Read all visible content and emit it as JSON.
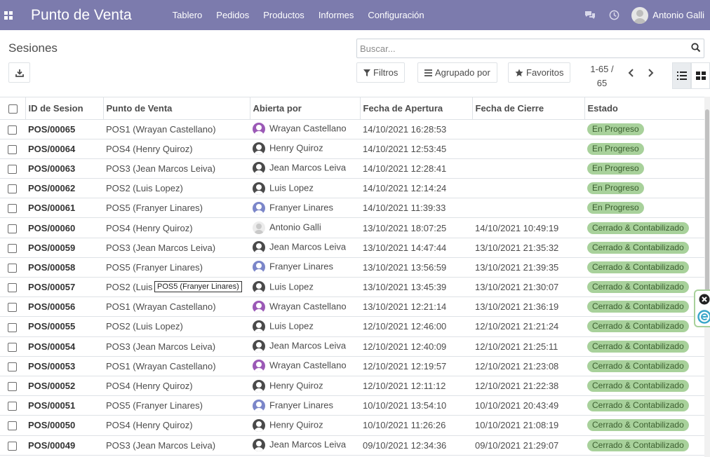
{
  "navbar": {
    "brand": "Punto de Venta",
    "menu": [
      "Tablero",
      "Pedidos",
      "Productos",
      "Informes",
      "Configuración"
    ],
    "user_name": "Antonio Galli"
  },
  "control_panel": {
    "breadcrumb": "Sesiones",
    "search_placeholder": "Buscar...",
    "filters_label": "Filtros",
    "group_by_label": "Agrupado por",
    "favorites_label": "Favoritos",
    "pager_value": "1-65 /",
    "pager_total": "65"
  },
  "table": {
    "headers": [
      "ID de Sesion",
      "Punto de Venta",
      "Abierta por",
      "Fecha de Apertura",
      "Fecha de Cierre",
      "Estado"
    ],
    "tooltip": "POS5 (Franyer Linares)",
    "colors": {
      "status_badge": "#a8d19b",
      "navbar": "#7c7bad"
    },
    "rows": [
      {
        "id": "POS/00065",
        "pos": "POS1 (Wrayan Castellano)",
        "user": "Wrayan Castellano",
        "avatar": "#9b59b6",
        "open": "14/10/2021 16:28:53",
        "close": "",
        "state": "En Progreso"
      },
      {
        "id": "POS/00064",
        "pos": "POS4 (Henry Quiroz)",
        "user": "Henry Quiroz",
        "avatar": "#4a4a4a",
        "open": "14/10/2021 12:53:45",
        "close": "",
        "state": "En Progreso"
      },
      {
        "id": "POS/00063",
        "pos": "POS3 (Jean Marcos Leiva)",
        "user": "Jean Marcos Leiva",
        "avatar": "#4a4a4a",
        "open": "14/10/2021 12:28:41",
        "close": "",
        "state": "En Progreso"
      },
      {
        "id": "POS/00062",
        "pos": "POS2 (Luis Lopez)",
        "user": "Luis Lopez",
        "avatar": "#4a4a4a",
        "open": "14/10/2021 12:14:24",
        "close": "",
        "state": "En Progreso"
      },
      {
        "id": "POS/00061",
        "pos": "POS5 (Franyer Linares)",
        "user": "Franyer Linares",
        "avatar": "#7b86c9",
        "open": "14/10/2021 11:39:33",
        "close": "",
        "state": "En Progreso"
      },
      {
        "id": "POS/00060",
        "pos": "POS4 (Henry Quiroz)",
        "user": "Antonio Galli",
        "avatar": "light",
        "open": "13/10/2021 18:07:25",
        "close": "14/10/2021 10:49:19",
        "state": "Cerrado & Contabilizado"
      },
      {
        "id": "POS/00059",
        "pos": "POS3 (Jean Marcos Leiva)",
        "user": "Jean Marcos Leiva",
        "avatar": "#4a4a4a",
        "open": "13/10/2021 14:47:44",
        "close": "13/10/2021 21:35:32",
        "state": "Cerrado & Contabilizado"
      },
      {
        "id": "POS/00058",
        "pos": "POS5 (Franyer Linares)",
        "user": "Franyer Linares",
        "avatar": "#7b86c9",
        "open": "13/10/2021 13:56:59",
        "close": "13/10/2021 21:39:35",
        "state": "Cerrado & Contabilizado"
      },
      {
        "id": "POS/00057",
        "pos": "POS2 (Luis",
        "user": "Luis Lopez",
        "avatar": "#4a4a4a",
        "open": "13/10/2021 13:45:39",
        "close": "13/10/2021 21:30:07",
        "state": "Cerrado & Contabilizado"
      },
      {
        "id": "POS/00056",
        "pos": "POS1 (Wrayan Castellano)",
        "user": "Wrayan Castellano",
        "avatar": "#9b59b6",
        "open": "13/10/2021 12:21:14",
        "close": "13/10/2021 21:36:19",
        "state": "Cerrado & Contabilizado"
      },
      {
        "id": "POS/00055",
        "pos": "POS2 (Luis Lopez)",
        "user": "Luis Lopez",
        "avatar": "#4a4a4a",
        "open": "12/10/2021 12:46:00",
        "close": "12/10/2021 21:21:24",
        "state": "Cerrado & Contabilizado"
      },
      {
        "id": "POS/00054",
        "pos": "POS3 (Jean Marcos Leiva)",
        "user": "Jean Marcos Leiva",
        "avatar": "#4a4a4a",
        "open": "12/10/2021 12:40:09",
        "close": "12/10/2021 21:25:11",
        "state": "Cerrado & Contabilizado"
      },
      {
        "id": "POS/00053",
        "pos": "POS1 (Wrayan Castellano)",
        "user": "Wrayan Castellano",
        "avatar": "#9b59b6",
        "open": "12/10/2021 12:19:57",
        "close": "12/10/2021 21:23:08",
        "state": "Cerrado & Contabilizado"
      },
      {
        "id": "POS/00052",
        "pos": "POS4 (Henry Quiroz)",
        "user": "Henry Quiroz",
        "avatar": "#4a4a4a",
        "open": "12/10/2021 12:11:12",
        "close": "12/10/2021 21:22:38",
        "state": "Cerrado & Contabilizado"
      },
      {
        "id": "POS/00051",
        "pos": "POS5 (Franyer Linares)",
        "user": "Franyer Linares",
        "avatar": "#7b86c9",
        "open": "10/10/2021 13:54:10",
        "close": "10/10/2021 20:43:49",
        "state": "Cerrado & Contabilizado"
      },
      {
        "id": "POS/00050",
        "pos": "POS4 (Henry Quiroz)",
        "user": "Henry Quiroz",
        "avatar": "#4a4a4a",
        "open": "10/10/2021 11:26:26",
        "close": "10/10/2021 21:08:19",
        "state": "Cerrado & Contabilizado"
      },
      {
        "id": "POS/00049",
        "pos": "POS3 (Jean Marcos Leiva)",
        "user": "Jean Marcos Leiva",
        "avatar": "#4a4a4a",
        "open": "09/10/2021 12:34:36",
        "close": "09/10/2021 21:29:07",
        "state": "Cerrado & Contabilizado"
      }
    ]
  }
}
